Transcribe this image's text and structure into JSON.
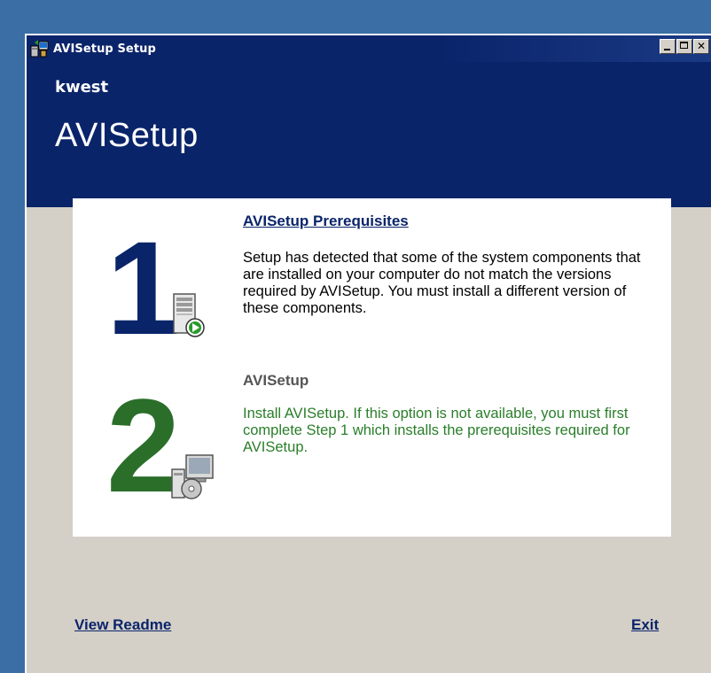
{
  "window": {
    "title": "AVISetup Setup"
  },
  "header": {
    "company": "kwest",
    "product": "AVISetup"
  },
  "steps": [
    {
      "number": "1",
      "title": "AVISetup Prerequisites",
      "description": "Setup has detected that some of the system components that are installed on your computer do not match the versions required by AVISetup. You must install a different version of these components.",
      "icon": "server-install-icon"
    },
    {
      "number": "2",
      "title": "AVISetup",
      "description": "Install AVISetup. If this option is not available, you must first complete Step 1 which installs the prerequisites required for AVISetup.",
      "icon": "computer-cd-icon"
    }
  ],
  "footer": {
    "readme_label": "View Readme",
    "exit_label": "Exit"
  },
  "colors": {
    "desktop": "#3a6ea5",
    "header": "#0a246a",
    "step1_number": "#0a246a",
    "step2_number": "#2a6e2a",
    "step2_text": "#2a7e2a"
  }
}
